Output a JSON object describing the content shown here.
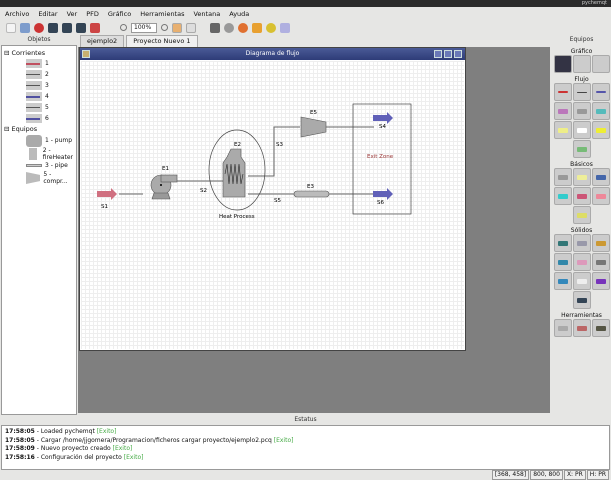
{
  "window": {
    "title": "pychemqt"
  },
  "menu": [
    "Archivo",
    "Editar",
    "Ver",
    "PFD",
    "Gráfico",
    "Herramientas",
    "Ventana",
    "Ayuda"
  ],
  "toolbar": {
    "zoom": "100%"
  },
  "left_dock": {
    "title": "Objetos",
    "groups": [
      {
        "label": "Corrientes",
        "items": [
          {
            "label": "1",
            "color": "#c05060"
          },
          {
            "label": "2",
            "color": "#555"
          },
          {
            "label": "3",
            "color": "#555"
          },
          {
            "label": "4",
            "color": "#5050a0"
          },
          {
            "label": "5",
            "color": "#555"
          },
          {
            "label": "6",
            "color": "#5050a0"
          }
        ]
      },
      {
        "label": "Equipos",
        "items": [
          {
            "label": "1 - pump"
          },
          {
            "label": "2 - fireHeater"
          },
          {
            "label": "3 - pipe"
          },
          {
            "label": "5 - compr..."
          }
        ]
      }
    ]
  },
  "tabs": [
    {
      "label": "ejemplo2"
    },
    {
      "label": "Proyecto Nuevo 1"
    }
  ],
  "subwindow": {
    "title": "Diagrama de flujo"
  },
  "diagram": {
    "labels": {
      "s1": "S1",
      "s2": "S2",
      "s3": "S3",
      "s4": "S4",
      "s5": "S5",
      "s6": "S6",
      "e1": "E1",
      "e2": "E2",
      "e3": "E3",
      "e5": "E5",
      "heat": "Heat Process",
      "exit": "Exit Zone"
    }
  },
  "right_dock": {
    "title": "Equipos",
    "sections": [
      "Gráfico",
      "Flujo",
      "Básicos",
      "Sólidos",
      "Herramientas"
    ]
  },
  "status_dock": {
    "title": "Estatus",
    "log": [
      {
        "time": "17:58:05",
        "msg": " - Loaded pychemqt ",
        "res": "[Exito]"
      },
      {
        "time": "17:58:05",
        "msg": " - Cargar /home/jjgomera/Programacion/ficheros cargar proyecto/ejemplo2.pcq ",
        "res": "[Exito]"
      },
      {
        "time": "17:58:09",
        "msg": " - Nuevo proyecto creado ",
        "res": "[Exito]"
      },
      {
        "time": "17:58:16",
        "msg": " - Configuración del proyecto ",
        "res": "[Exito]"
      }
    ]
  },
  "statusbar": [
    "[368, 458]",
    "800, 800",
    "X: PR",
    "H: PR"
  ]
}
